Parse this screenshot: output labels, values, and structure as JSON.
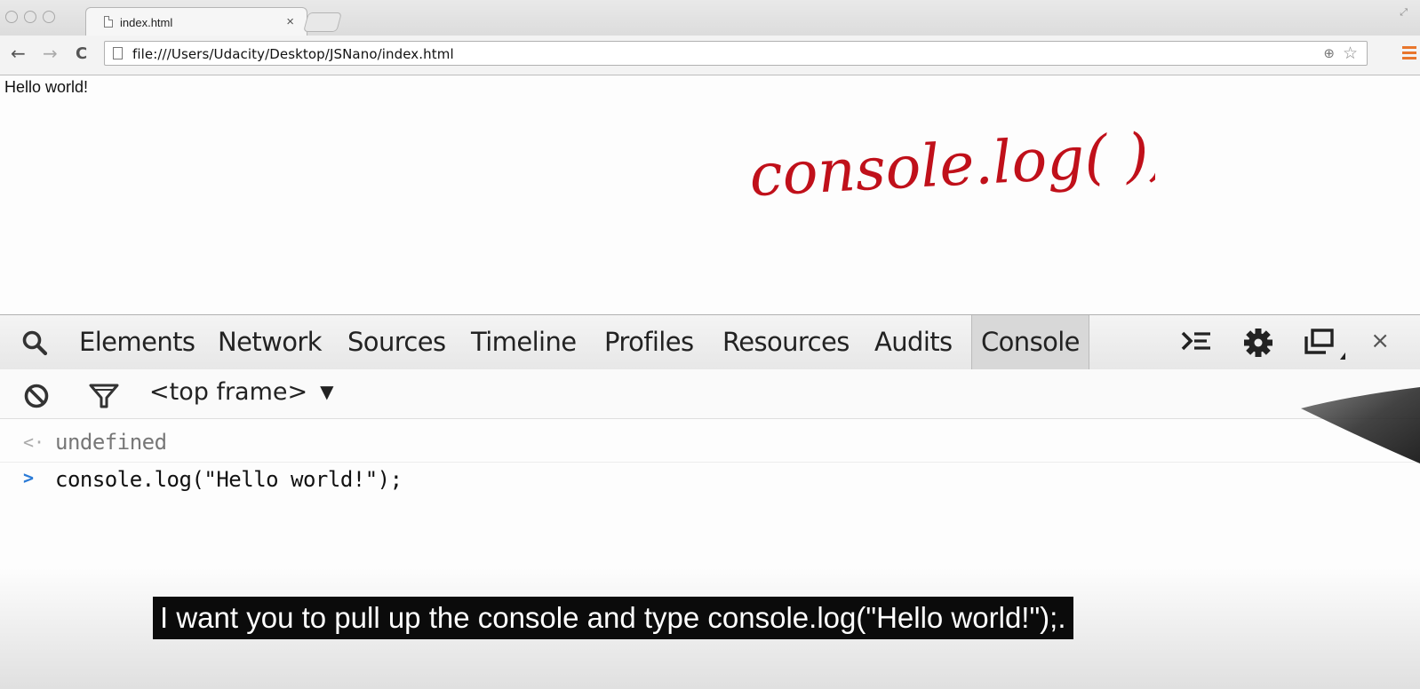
{
  "browser": {
    "tab_title": "index.html",
    "tab_close": "×",
    "url": "file:///Users/Udacity/Desktop/JSNano/index.html",
    "nav": {
      "back": "←",
      "forward": "→",
      "reload": "C"
    },
    "zoom_glyph": "⊕",
    "star_glyph": "☆",
    "accent_color": "#e8762c"
  },
  "page": {
    "body_text": "Hello world!",
    "handwriting": "console.log( );",
    "handwriting_color": "#c0101a"
  },
  "devtools": {
    "tabs": [
      {
        "label": "Elements"
      },
      {
        "label": "Network"
      },
      {
        "label": "Sources"
      },
      {
        "label": "Timeline"
      },
      {
        "label": "Profiles"
      },
      {
        "label": "Resources"
      },
      {
        "label": "Audits"
      },
      {
        "label": "Console",
        "active": true
      }
    ],
    "close_glyph": "×",
    "frame_selector": "<top frame>",
    "frame_arrow": "▼"
  },
  "console": {
    "lines": [
      {
        "kind": "result",
        "gutter": "<·",
        "text": "undefined"
      },
      {
        "kind": "input",
        "gutter": ">",
        "text": "console.log(\"Hello world!\");"
      }
    ]
  },
  "subtitle": "I want you to pull up the console and type console.log(\"Hello world!\");."
}
